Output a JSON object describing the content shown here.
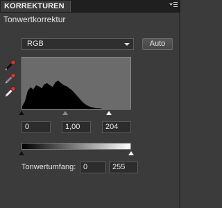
{
  "panel": {
    "tab_label": "KORREKTUREN",
    "menu_icon": "panel-menu-icon",
    "title": "Tonwertkorrektur"
  },
  "controls": {
    "channel": "RGB",
    "auto_label": "Auto"
  },
  "input_levels": {
    "black": "0",
    "gamma": "1,00",
    "white": "204"
  },
  "output_levels": {
    "label": "Tonwertumfang:",
    "black": "0",
    "white": "255"
  },
  "histogram": {
    "range": [
      0,
      255
    ],
    "relative_counts": [
      0.05,
      0.15,
      0.35,
      0.42,
      0.38,
      0.46,
      0.44,
      0.4,
      0.48,
      0.5,
      0.46,
      0.43,
      0.52,
      0.55,
      0.5,
      0.46,
      0.44,
      0.4,
      0.36,
      0.3,
      0.24,
      0.18,
      0.12,
      0.08,
      0.05,
      0.03,
      0.02,
      0.01,
      0.01,
      0.0,
      0.0,
      0.0,
      0.0,
      0.0,
      0.0,
      0.0,
      0.0,
      0.0,
      0.0,
      0.0
    ],
    "slider_fractions": {
      "black": 0.0,
      "gamma": 0.4,
      "white": 0.8
    }
  },
  "colors": {
    "panel_bg": "#3b3b3b",
    "histogram_bg": "#6b6b6b",
    "histogram_fill": "#000000",
    "dropper_black": "#111111",
    "dropper_gray": "#8a8a8a",
    "dropper_white": "#f0f0f0"
  }
}
